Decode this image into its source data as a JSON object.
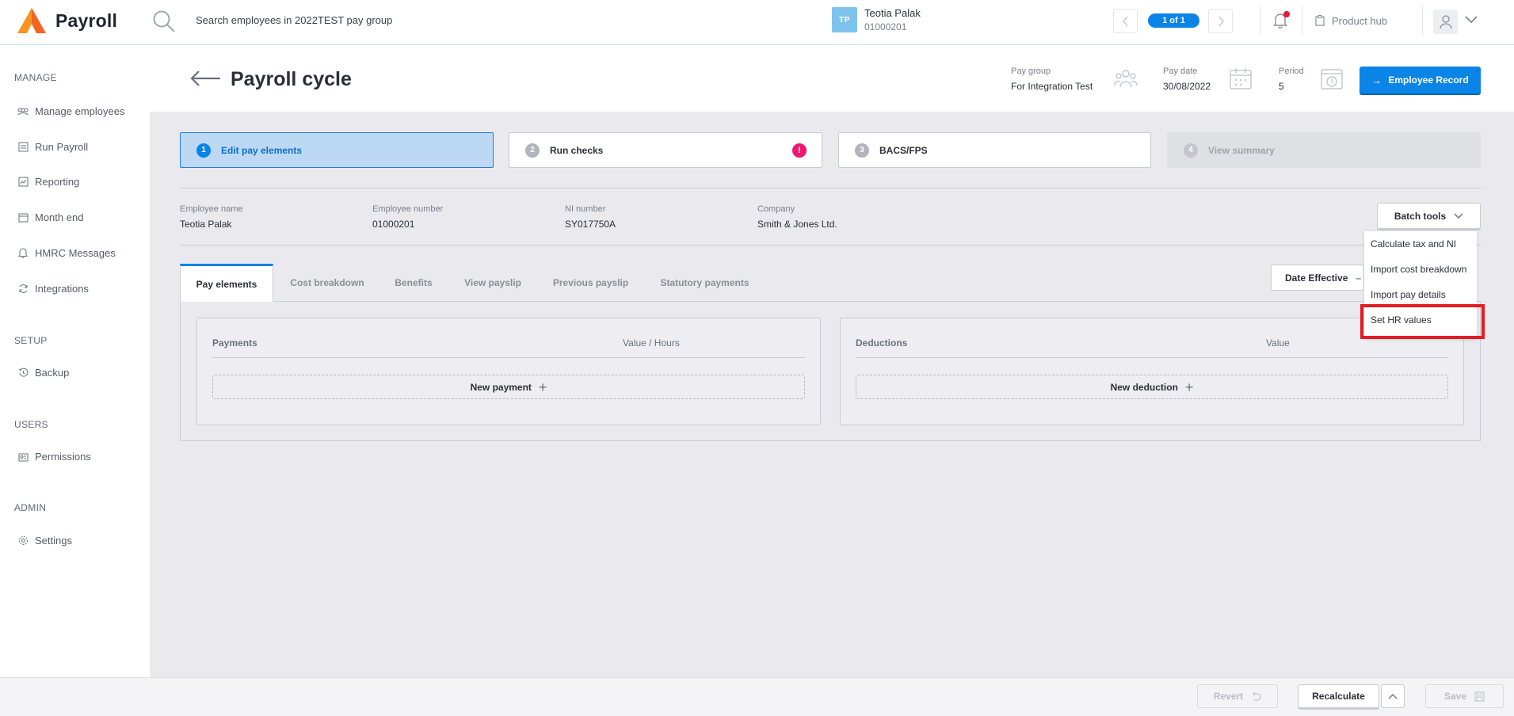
{
  "app": {
    "title": "Payroll",
    "brand_color": "#f26522"
  },
  "search": {
    "placeholder": "Search employees in 2022TEST pay group"
  },
  "employee": {
    "initials": "TP",
    "name": "Teotia Palak",
    "number": "01000201"
  },
  "pager": {
    "label": "1 of 1"
  },
  "topnav": {
    "product_hub": "Product hub"
  },
  "sidebar": {
    "sections": [
      {
        "label": "MANAGE",
        "items": [
          {
            "label": "Manage employees",
            "icon": "people-icon"
          },
          {
            "label": "Run Payroll",
            "icon": "payroll-icon"
          },
          {
            "label": "Reporting",
            "icon": "chart-icon"
          },
          {
            "label": "Month end",
            "icon": "calendar-icon"
          },
          {
            "label": "HMRC Messages",
            "icon": "bell-icon"
          },
          {
            "label": "Integrations",
            "icon": "sync-icon"
          }
        ]
      },
      {
        "label": "SETUP",
        "items": [
          {
            "label": "Backup",
            "icon": "history-icon"
          }
        ]
      },
      {
        "label": "USERS",
        "items": [
          {
            "label": "Permissions",
            "icon": "id-card-icon"
          }
        ]
      },
      {
        "label": "ADMIN",
        "items": [
          {
            "label": "Settings",
            "icon": "gear-icon"
          }
        ]
      }
    ]
  },
  "header": {
    "title": "Payroll cycle",
    "pay_group_label": "Pay group",
    "pay_group_value": "For Integration Test",
    "pay_date_label": "Pay date",
    "pay_date_value": "30/08/2022",
    "period_label": "Period",
    "period_value": "5",
    "record_button": "Employee Record",
    "accent": "#0a84e6"
  },
  "steps": [
    {
      "num": "1",
      "label": "Edit pay elements",
      "state": "active"
    },
    {
      "num": "2",
      "label": "Run checks",
      "state": "default",
      "alert": "!"
    },
    {
      "num": "3",
      "label": "BACS/FPS",
      "state": "default"
    },
    {
      "num": "4",
      "label": "View summary",
      "state": "disabled"
    }
  ],
  "info": {
    "employee_name_label": "Employee name",
    "employee_name_value": "Teotia Palak",
    "employee_number_label": "Employee number",
    "employee_number_value": "01000201",
    "ni_label": "NI number",
    "ni_value": "SY017750A",
    "company_label": "Company",
    "company_value": "Smith & Jones Ltd."
  },
  "batch_tools": {
    "label": "Batch tools",
    "items": [
      "Calculate tax and NI",
      "Import cost breakdown",
      "Import pay details",
      "Set HR values"
    ],
    "highlighted": "Set HR values",
    "highlight_color": "#e31c24"
  },
  "tabs": [
    "Pay elements",
    "Cost breakdown",
    "Benefits",
    "View payslip",
    "Previous payslip",
    "Statutory payments"
  ],
  "date_effective": {
    "label": "Date Effective"
  },
  "payments": {
    "title": "Payments",
    "column": "Value / Hours",
    "new_label": "New payment"
  },
  "deductions": {
    "title": "Deductions",
    "column": "Value",
    "new_label": "New deduction"
  },
  "footer": {
    "revert": "Revert",
    "recalculate": "Recalculate",
    "save": "Save"
  }
}
